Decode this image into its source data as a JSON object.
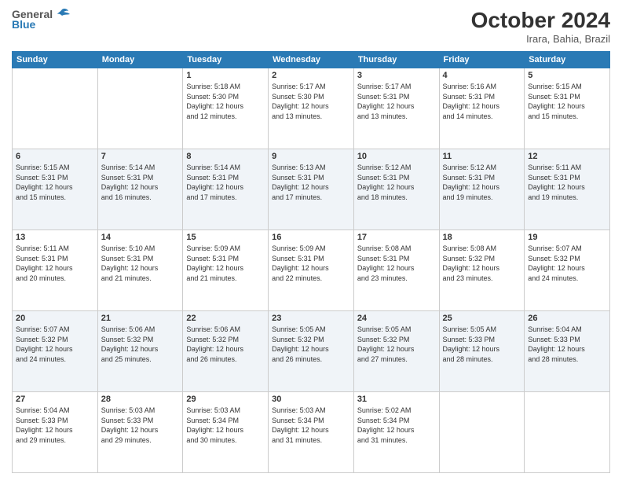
{
  "logo": {
    "line1": "General",
    "line2": "Blue"
  },
  "title": "October 2024",
  "location": "Irara, Bahia, Brazil",
  "days_of_week": [
    "Sunday",
    "Monday",
    "Tuesday",
    "Wednesday",
    "Thursday",
    "Friday",
    "Saturday"
  ],
  "weeks": [
    [
      {
        "day": "",
        "info": ""
      },
      {
        "day": "",
        "info": ""
      },
      {
        "day": "1",
        "info": "Sunrise: 5:18 AM\nSunset: 5:30 PM\nDaylight: 12 hours\nand 12 minutes."
      },
      {
        "day": "2",
        "info": "Sunrise: 5:17 AM\nSunset: 5:30 PM\nDaylight: 12 hours\nand 13 minutes."
      },
      {
        "day": "3",
        "info": "Sunrise: 5:17 AM\nSunset: 5:31 PM\nDaylight: 12 hours\nand 13 minutes."
      },
      {
        "day": "4",
        "info": "Sunrise: 5:16 AM\nSunset: 5:31 PM\nDaylight: 12 hours\nand 14 minutes."
      },
      {
        "day": "5",
        "info": "Sunrise: 5:15 AM\nSunset: 5:31 PM\nDaylight: 12 hours\nand 15 minutes."
      }
    ],
    [
      {
        "day": "6",
        "info": "Sunrise: 5:15 AM\nSunset: 5:31 PM\nDaylight: 12 hours\nand 15 minutes."
      },
      {
        "day": "7",
        "info": "Sunrise: 5:14 AM\nSunset: 5:31 PM\nDaylight: 12 hours\nand 16 minutes."
      },
      {
        "day": "8",
        "info": "Sunrise: 5:14 AM\nSunset: 5:31 PM\nDaylight: 12 hours\nand 17 minutes."
      },
      {
        "day": "9",
        "info": "Sunrise: 5:13 AM\nSunset: 5:31 PM\nDaylight: 12 hours\nand 17 minutes."
      },
      {
        "day": "10",
        "info": "Sunrise: 5:12 AM\nSunset: 5:31 PM\nDaylight: 12 hours\nand 18 minutes."
      },
      {
        "day": "11",
        "info": "Sunrise: 5:12 AM\nSunset: 5:31 PM\nDaylight: 12 hours\nand 19 minutes."
      },
      {
        "day": "12",
        "info": "Sunrise: 5:11 AM\nSunset: 5:31 PM\nDaylight: 12 hours\nand 19 minutes."
      }
    ],
    [
      {
        "day": "13",
        "info": "Sunrise: 5:11 AM\nSunset: 5:31 PM\nDaylight: 12 hours\nand 20 minutes."
      },
      {
        "day": "14",
        "info": "Sunrise: 5:10 AM\nSunset: 5:31 PM\nDaylight: 12 hours\nand 21 minutes."
      },
      {
        "day": "15",
        "info": "Sunrise: 5:09 AM\nSunset: 5:31 PM\nDaylight: 12 hours\nand 21 minutes."
      },
      {
        "day": "16",
        "info": "Sunrise: 5:09 AM\nSunset: 5:31 PM\nDaylight: 12 hours\nand 22 minutes."
      },
      {
        "day": "17",
        "info": "Sunrise: 5:08 AM\nSunset: 5:31 PM\nDaylight: 12 hours\nand 23 minutes."
      },
      {
        "day": "18",
        "info": "Sunrise: 5:08 AM\nSunset: 5:32 PM\nDaylight: 12 hours\nand 23 minutes."
      },
      {
        "day": "19",
        "info": "Sunrise: 5:07 AM\nSunset: 5:32 PM\nDaylight: 12 hours\nand 24 minutes."
      }
    ],
    [
      {
        "day": "20",
        "info": "Sunrise: 5:07 AM\nSunset: 5:32 PM\nDaylight: 12 hours\nand 24 minutes."
      },
      {
        "day": "21",
        "info": "Sunrise: 5:06 AM\nSunset: 5:32 PM\nDaylight: 12 hours\nand 25 minutes."
      },
      {
        "day": "22",
        "info": "Sunrise: 5:06 AM\nSunset: 5:32 PM\nDaylight: 12 hours\nand 26 minutes."
      },
      {
        "day": "23",
        "info": "Sunrise: 5:05 AM\nSunset: 5:32 PM\nDaylight: 12 hours\nand 26 minutes."
      },
      {
        "day": "24",
        "info": "Sunrise: 5:05 AM\nSunset: 5:32 PM\nDaylight: 12 hours\nand 27 minutes."
      },
      {
        "day": "25",
        "info": "Sunrise: 5:05 AM\nSunset: 5:33 PM\nDaylight: 12 hours\nand 28 minutes."
      },
      {
        "day": "26",
        "info": "Sunrise: 5:04 AM\nSunset: 5:33 PM\nDaylight: 12 hours\nand 28 minutes."
      }
    ],
    [
      {
        "day": "27",
        "info": "Sunrise: 5:04 AM\nSunset: 5:33 PM\nDaylight: 12 hours\nand 29 minutes."
      },
      {
        "day": "28",
        "info": "Sunrise: 5:03 AM\nSunset: 5:33 PM\nDaylight: 12 hours\nand 29 minutes."
      },
      {
        "day": "29",
        "info": "Sunrise: 5:03 AM\nSunset: 5:34 PM\nDaylight: 12 hours\nand 30 minutes."
      },
      {
        "day": "30",
        "info": "Sunrise: 5:03 AM\nSunset: 5:34 PM\nDaylight: 12 hours\nand 31 minutes."
      },
      {
        "day": "31",
        "info": "Sunrise: 5:02 AM\nSunset: 5:34 PM\nDaylight: 12 hours\nand 31 minutes."
      },
      {
        "day": "",
        "info": ""
      },
      {
        "day": "",
        "info": ""
      }
    ]
  ]
}
